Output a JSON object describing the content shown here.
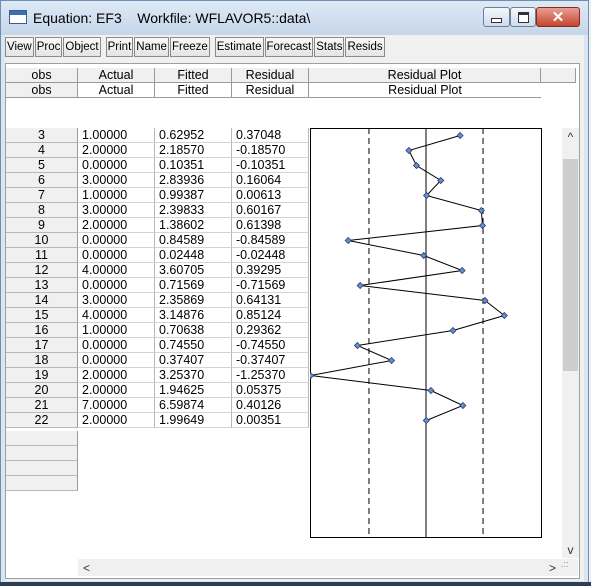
{
  "window": {
    "title": "Equation: EF3    Workfile: WFLAVOR5::data\\",
    "minimize_icon": "minimize-icon",
    "maximize_icon": "maximize-icon",
    "close_icon": "close-icon",
    "close_glyph": "✕"
  },
  "toolbar": {
    "buttons": [
      "View",
      "Proc",
      "Object",
      "Print",
      "Name",
      "Freeze",
      "Estimate",
      "Forecast",
      "Stats",
      "Resids"
    ]
  },
  "table": {
    "columns": [
      "obs",
      "Actual",
      "Fitted",
      "Residual",
      "Residual Plot"
    ],
    "subheader": [
      "obs",
      "Actual",
      "Fitted",
      "Residual",
      "Residual Plot"
    ],
    "rows": [
      {
        "obs": "3",
        "actual": "1.00000",
        "fitted": "0.62952",
        "residual": "0.37048"
      },
      {
        "obs": "4",
        "actual": "2.00000",
        "fitted": "2.18570",
        "residual": "-0.18570"
      },
      {
        "obs": "5",
        "actual": "0.00000",
        "fitted": "0.10351",
        "residual": "-0.10351"
      },
      {
        "obs": "6",
        "actual": "3.00000",
        "fitted": "2.83936",
        "residual": "0.16064"
      },
      {
        "obs": "7",
        "actual": "1.00000",
        "fitted": "0.99387",
        "residual": "0.00613"
      },
      {
        "obs": "8",
        "actual": "3.00000",
        "fitted": "2.39833",
        "residual": "0.60167"
      },
      {
        "obs": "9",
        "actual": "2.00000",
        "fitted": "1.38602",
        "residual": "0.61398"
      },
      {
        "obs": "10",
        "actual": "0.00000",
        "fitted": "0.84589",
        "residual": "-0.84589"
      },
      {
        "obs": "11",
        "actual": "0.00000",
        "fitted": "0.02448",
        "residual": "-0.02448"
      },
      {
        "obs": "12",
        "actual": "4.00000",
        "fitted": "3.60705",
        "residual": "0.39295"
      },
      {
        "obs": "13",
        "actual": "0.00000",
        "fitted": "0.71569",
        "residual": "-0.71569"
      },
      {
        "obs": "14",
        "actual": "3.00000",
        "fitted": "2.35869",
        "residual": "0.64131"
      },
      {
        "obs": "15",
        "actual": "4.00000",
        "fitted": "3.14876",
        "residual": "0.85124"
      },
      {
        "obs": "16",
        "actual": "1.00000",
        "fitted": "0.70638",
        "residual": "0.29362"
      },
      {
        "obs": "17",
        "actual": "0.00000",
        "fitted": "0.74550",
        "residual": "-0.74550"
      },
      {
        "obs": "18",
        "actual": "0.00000",
        "fitted": "0.37407",
        "residual": "-0.37407"
      },
      {
        "obs": "19",
        "actual": "2.00000",
        "fitted": "3.25370",
        "residual": "-1.25370"
      },
      {
        "obs": "20",
        "actual": "2.00000",
        "fitted": "1.94625",
        "residual": "0.05375"
      },
      {
        "obs": "21",
        "actual": "7.00000",
        "fitted": "6.59874",
        "residual": "0.40126"
      },
      {
        "obs": "22",
        "actual": "2.00000",
        "fitted": "1.99649",
        "residual": "0.00351"
      }
    ]
  },
  "chart_data": {
    "type": "line",
    "residuals": [
      0.37048,
      -0.1857,
      -0.10351,
      0.16064,
      0.00613,
      0.60167,
      0.61398,
      -0.84589,
      -0.02448,
      0.39295,
      -0.71569,
      0.64131,
      0.85124,
      0.29362,
      -0.7455,
      -0.37407,
      -1.2537,
      0.05375,
      0.40126,
      0.00351
    ],
    "zero_line": 0,
    "sigma_band": 0.62
  },
  "scrollbars": {
    "up": "^",
    "down": "v",
    "left": "<",
    "right": ">",
    "grip": ".::"
  }
}
